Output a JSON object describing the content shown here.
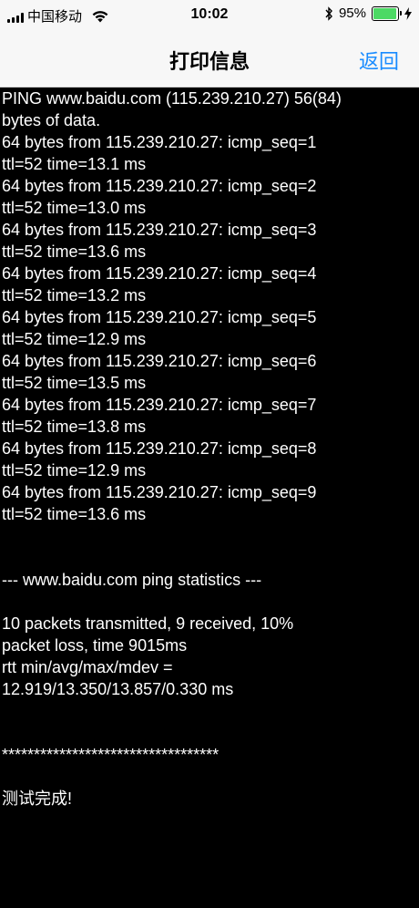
{
  "status_bar": {
    "carrier": "中国移动",
    "time": "10:02",
    "battery_percent": "95%",
    "battery_level": 0.95,
    "icons": [
      "signal-icon",
      "wifi-icon",
      "bluetooth-icon",
      "battery-icon",
      "charging-icon"
    ]
  },
  "nav": {
    "title": "打印信息",
    "back_label": "返回"
  },
  "console": {
    "lines": [
      "PING www.baidu.com (115.239.210.27) 56(84)",
      "bytes of data.",
      "64 bytes from 115.239.210.27: icmp_seq=1",
      "ttl=52 time=13.1 ms",
      "64 bytes from 115.239.210.27: icmp_seq=2",
      "ttl=52 time=13.0 ms",
      "64 bytes from 115.239.210.27: icmp_seq=3",
      "ttl=52 time=13.6 ms",
      "64 bytes from 115.239.210.27: icmp_seq=4",
      "ttl=52 time=13.2 ms",
      "64 bytes from 115.239.210.27: icmp_seq=5",
      "ttl=52 time=12.9 ms",
      "64 bytes from 115.239.210.27: icmp_seq=6",
      "ttl=52 time=13.5 ms",
      "64 bytes from 115.239.210.27: icmp_seq=7",
      "ttl=52 time=13.8 ms",
      "64 bytes from 115.239.210.27: icmp_seq=8",
      "ttl=52 time=12.9 ms",
      "64 bytes from 115.239.210.27: icmp_seq=9",
      "ttl=52 time=13.6 ms",
      "",
      "",
      "--- www.baidu.com ping statistics ---",
      "",
      "10 packets transmitted, 9 received, 10%",
      "packet loss, time 9015ms",
      "rtt min/avg/max/mdev =",
      "12.919/13.350/13.857/0.330 ms",
      "",
      "",
      "**********************************",
      "",
      "测试完成!"
    ]
  }
}
